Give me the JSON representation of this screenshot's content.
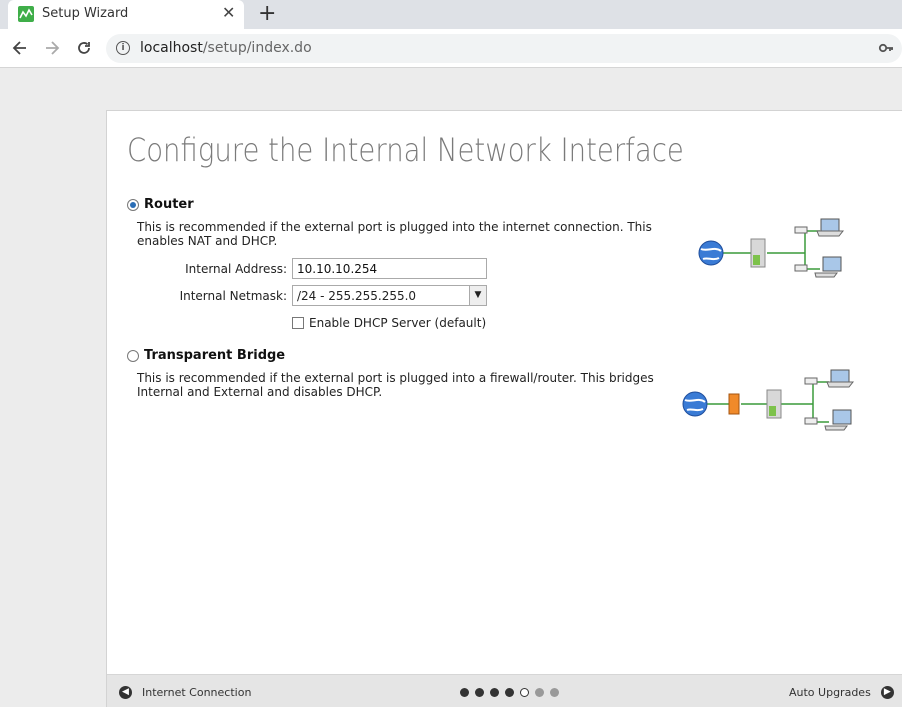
{
  "browser": {
    "tab_title": "Setup Wizard",
    "tab_close": "✕",
    "new_tab": "+",
    "url_host": "localhost",
    "url_path": "/setup/index.do"
  },
  "page": {
    "title": "Configure the Internal Network Interface",
    "router": {
      "label": "Router",
      "selected": true,
      "description": "This is recommended if the external port is plugged into the internet connection. This enables NAT and DHCP.",
      "internal_address_label": "Internal Address:",
      "internal_address_value": "10.10.10.254",
      "internal_netmask_label": "Internal Netmask:",
      "internal_netmask_value": "/24 - 255.255.255.0",
      "dhcp_label": "Enable DHCP Server (default)",
      "dhcp_checked": false
    },
    "bridge": {
      "label": "Transparent Bridge",
      "selected": false,
      "description": "This is recommended if the external port is plugged into a firewall/router. This bridges Internal and External and disables DHCP."
    }
  },
  "footer": {
    "prev_label": "Internet Connection",
    "next_label": "Auto Upgrades",
    "steps_total": 7,
    "current_step": 5
  }
}
